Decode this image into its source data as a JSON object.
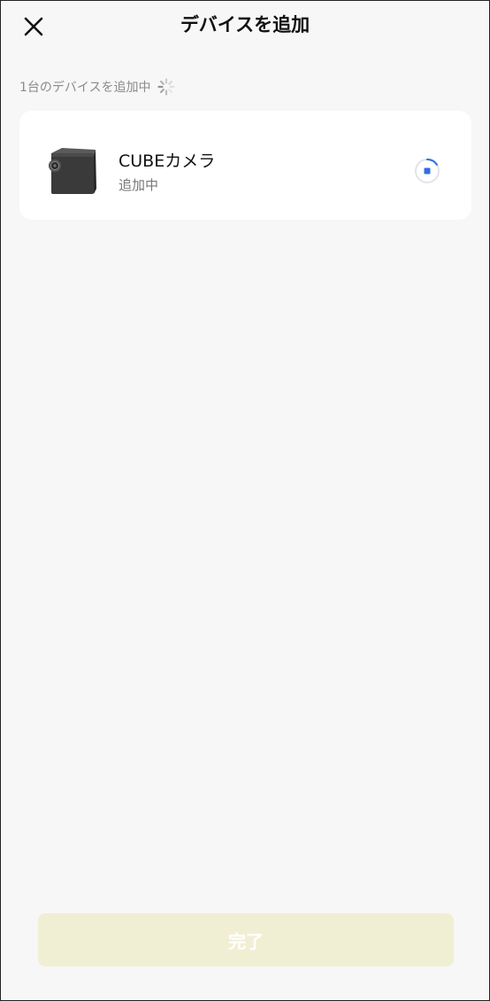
{
  "header": {
    "title": "デバイスを追加",
    "close_icon": "close-icon"
  },
  "status": {
    "text": "1台のデバイスを追加中",
    "spinner_icon": "loading-spinner-icon"
  },
  "device": {
    "name": "CUBEカメラ",
    "status": "追加中",
    "image_icon": "cube-camera-image",
    "progress_icon": "progress-ring-icon"
  },
  "footer": {
    "done_label": "完了",
    "done_enabled": false
  },
  "colors": {
    "background": "#f7f7f7",
    "card": "#ffffff",
    "accent": "#2f6fe4",
    "button_disabled": "#f1efd3"
  }
}
